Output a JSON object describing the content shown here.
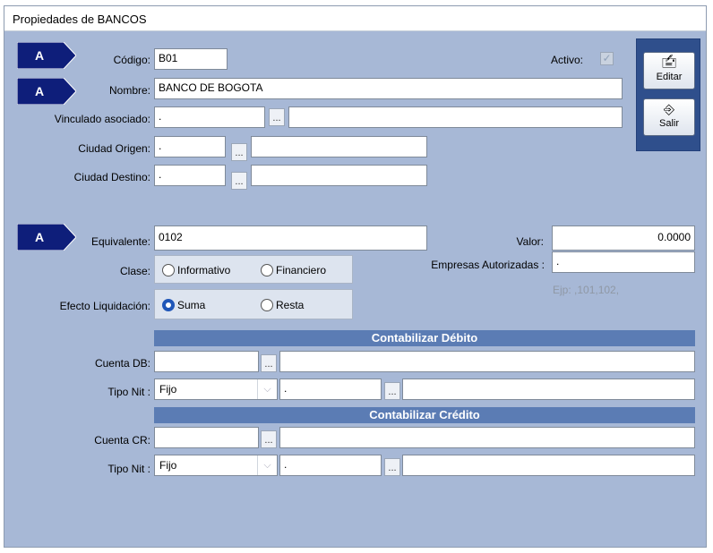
{
  "window": {
    "title": "Propiedades de BANCOS"
  },
  "badge_label": "A",
  "fields": {
    "codigo": {
      "label": "Código:",
      "value": "B01"
    },
    "activo_label": "Activo:",
    "nombre": {
      "label": "Nombre:",
      "value": "BANCO DE BOGOTA"
    },
    "vinculado": {
      "label": "Vinculado asociado:",
      "value": ".",
      "desc": ""
    },
    "ciudad_origen": {
      "label": "Ciudad Origen:",
      "value": ".",
      "desc": ""
    },
    "ciudad_destino": {
      "label": "Ciudad Destino:",
      "value": ".",
      "desc": ""
    },
    "equivalente": {
      "label": "Equivalente:",
      "value": "0102"
    },
    "valor": {
      "label": "Valor:",
      "value": "0.0000"
    },
    "clase": {
      "label": "Clase:",
      "options": [
        "Informativo",
        "Financiero"
      ]
    },
    "empresas": {
      "label": "Empresas Autorizadas :",
      "value": ".",
      "hint": "Ejp: ,101,102,"
    },
    "efecto": {
      "label": "Efecto Liquidación:",
      "options": [
        "Suma",
        "Resta"
      ],
      "selected": "Suma"
    }
  },
  "debito": {
    "header": "Contabilizar Débito",
    "cuenta_label": "Cuenta DB:",
    "tipo_nit_label": "Tipo Nit :",
    "tipo_nit_value": "Fijo",
    "nit_value": "."
  },
  "credito": {
    "header": "Contabilizar Crédito",
    "cuenta_label": "Cuenta CR:",
    "tipo_nit_label": "Tipo Nit :",
    "tipo_nit_value": "Fijo",
    "nit_value": "."
  },
  "buttons": {
    "editar": "Editar",
    "salir": "Salir",
    "dots": "..."
  }
}
